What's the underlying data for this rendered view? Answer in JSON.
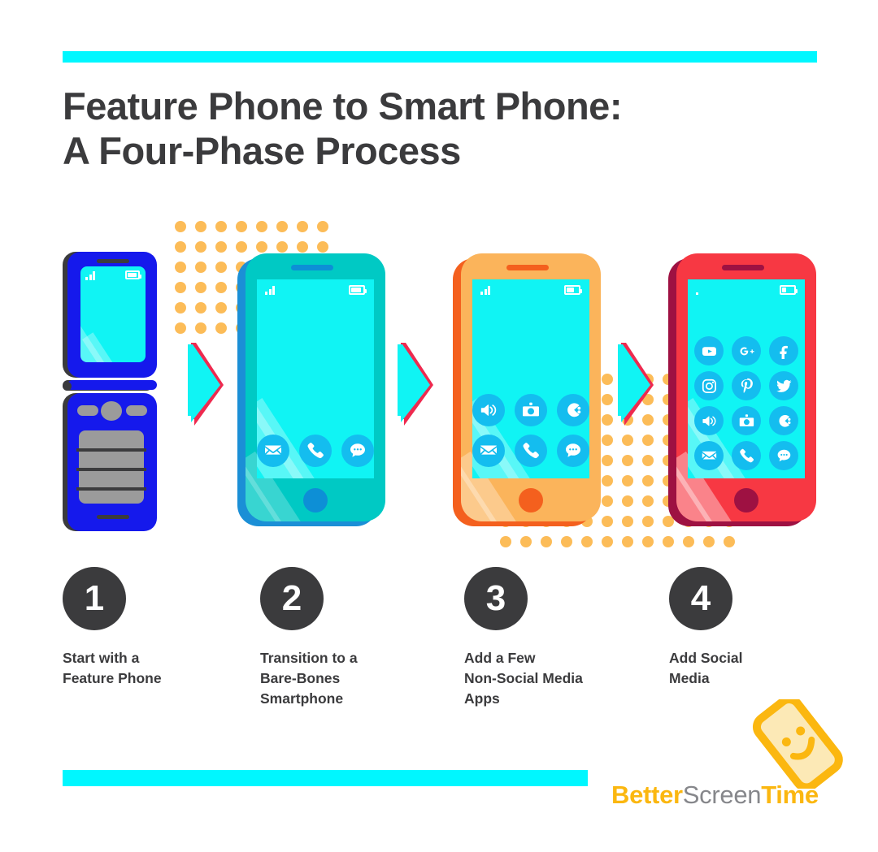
{
  "page": {
    "background": "#ffffff",
    "accent_bar_color": "#00F7FF",
    "title": "Feature Phone to Smart Phone:\nA Four-Phase Process",
    "text_color": "#3b3b3d",
    "dot_color": "#FBB03B"
  },
  "steps": [
    {
      "number": "1",
      "caption": "Start with a\nFeature Phone",
      "phone_kind": "feature-phone",
      "body_color": "#1519EC",
      "shadow_color": "#3b3b3d",
      "screen_color": "#10F4F4",
      "keypad_color": "#9b9b9b",
      "apps": []
    },
    {
      "number": "2",
      "caption": "Transition to a\nBare-Bones\nSmartphone",
      "phone_kind": "smartphone",
      "body_color": "#00C9C4",
      "shadow_color": "#1B8FD6",
      "accent_color": "#0D8FD6",
      "screen_color": "#10F4F4",
      "home_color": "#0D8FD6",
      "apps": [
        "mail-icon",
        "phone-icon",
        "message-icon"
      ]
    },
    {
      "number": "3",
      "caption": "Add a Few\nNon-Social Media\nApps",
      "phone_kind": "smartphone",
      "body_color": "#FBB45B",
      "shadow_color": "#F4601E",
      "accent_color": "#F4601E",
      "screen_color": "#10F4F4",
      "home_color": "#F4601E",
      "apps": [
        "speaker-icon",
        "camera-icon",
        "game-icon",
        "mail-icon",
        "phone-icon",
        "message-icon"
      ]
    },
    {
      "number": "4",
      "caption": "Add Social\nMedia",
      "phone_kind": "smartphone",
      "body_color": "#F73843",
      "shadow_color": "#9E1142",
      "accent_color": "#9E1142",
      "screen_color": "#10F4F4",
      "home_color": "#9E1142",
      "apps": [
        "youtube-icon",
        "googleplus-icon",
        "facebook-icon",
        "instagram-icon",
        "pinterest-icon",
        "twitter-icon",
        "speaker-icon",
        "camera-icon",
        "game-icon",
        "mail-icon",
        "phone-icon",
        "message-icon"
      ]
    }
  ],
  "arrows": {
    "count": 3,
    "fill": "#10F4F4",
    "outline": "#EE2A4F"
  },
  "status_bar": {
    "signal": "signal-bars-icon",
    "battery": "battery-icon"
  },
  "logo": {
    "word_better": "Better",
    "word_screen": "Screen",
    "word_time": "Time",
    "brand_color": "#FBB710",
    "neutral_color": "#86878b",
    "mark": "smiley-phone-icon"
  }
}
